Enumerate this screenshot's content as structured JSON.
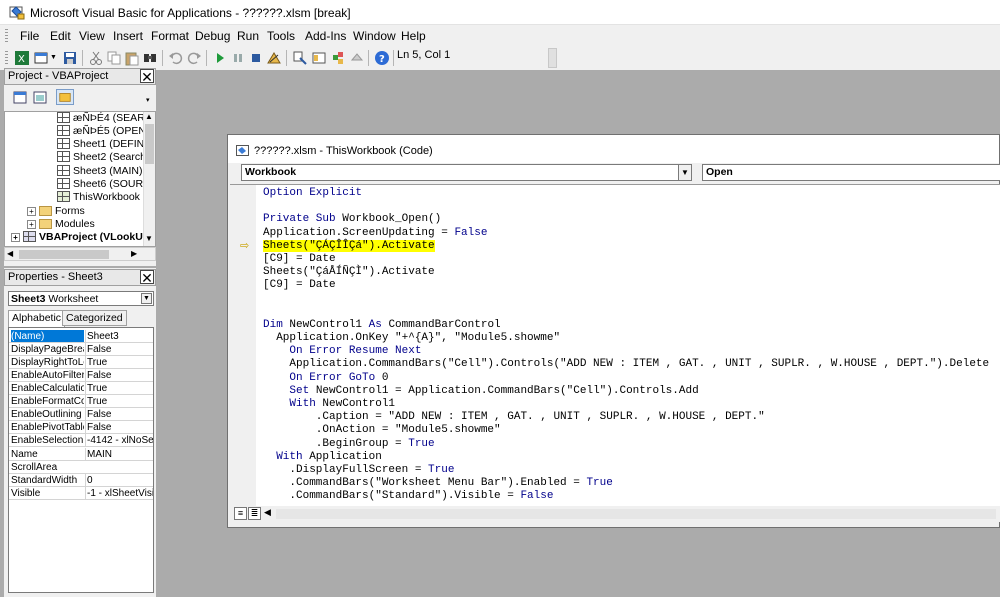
{
  "window": {
    "title": "Microsoft Visual Basic for Applications - ??????.xlsm [break]"
  },
  "menu": [
    "File",
    "Edit",
    "View",
    "Insert",
    "Format",
    "Debug",
    "Run",
    "Tools",
    "Add-Ins",
    "Window",
    "Help"
  ],
  "toolbar": {
    "icons": [
      "excel-icon",
      "insert-module-icon",
      "save-icon",
      "cut-icon",
      "copy-icon",
      "paste-icon",
      "find-icon",
      "undo-icon",
      "redo-icon",
      "run-icon",
      "break-icon",
      "reset-icon",
      "design-mode-icon",
      "project-explorer-icon",
      "properties-icon",
      "object-browser-icon",
      "toolbox-icon",
      "help-icon"
    ],
    "position": "Ln 5, Col 1"
  },
  "project": {
    "title": "Project - VBAProject",
    "close": "✕",
    "tree": [
      {
        "label": "æÑÞÉ4 (SEARCH",
        "type": "sheet"
      },
      {
        "label": "æÑÞÉ5 (OPENIN",
        "type": "sheet"
      },
      {
        "label": "Sheet1 (DEFINIT",
        "type": "sheet"
      },
      {
        "label": "Sheet2 (Search (",
        "type": "sheet"
      },
      {
        "label": "Sheet3 (MAIN)",
        "type": "sheet"
      },
      {
        "label": "Sheet6 (SOURCE",
        "type": "sheet"
      },
      {
        "label": "ThisWorkbook",
        "type": "workbook"
      },
      {
        "label": "Forms",
        "type": "folder"
      },
      {
        "label": "Modules",
        "type": "folder"
      },
      {
        "label": "VBAProject (VLookUp",
        "type": "project"
      }
    ]
  },
  "properties": {
    "title": "Properties - Sheet3",
    "close": "✕",
    "object_name": "Sheet3",
    "object_type": "Worksheet",
    "tabs": [
      "Alphabetic",
      "Categorized"
    ],
    "rows": [
      {
        "name": "(Name)",
        "value": "Sheet3"
      },
      {
        "name": "DisplayPageBreak",
        "value": "False"
      },
      {
        "name": "DisplayRightToLef",
        "value": "True"
      },
      {
        "name": "EnableAutoFilter",
        "value": "False"
      },
      {
        "name": "EnableCalculation",
        "value": "True"
      },
      {
        "name": "EnableFormatCon",
        "value": "True"
      },
      {
        "name": "EnableOutlining",
        "value": "False"
      },
      {
        "name": "EnablePivotTable",
        "value": "False"
      },
      {
        "name": "EnableSelection",
        "value": "-4142 - xlNoSele"
      },
      {
        "name": "Name",
        "value": "MAIN"
      },
      {
        "name": "ScrollArea",
        "value": ""
      },
      {
        "name": "StandardWidth",
        "value": "0"
      },
      {
        "name": "Visible",
        "value": "-1 - xlSheetVisib"
      }
    ]
  },
  "code_window": {
    "title": "??????.xlsm - ThisWorkbook (Code)",
    "object_combo": "Workbook",
    "proc_combo": "Open",
    "lines": [
      "Option Explicit",
      "",
      "Private Sub Workbook_Open()",
      "Application.ScreenUpdating = False",
      "Sheets(\"ÇÁÇÎÎÇá\").Activate",
      "[C9] = Date",
      "Sheets(\"ÇáÅÍÑÇÌ\").Activate",
      "[C9] = Date",
      "",
      "",
      "Dim NewControl1 As CommandBarControl",
      "  Application.OnKey \"+^{A}\", \"Module5.showme\"",
      "    On Error Resume Next",
      "    Application.CommandBars(\"Cell\").Controls(\"ADD NEW : ITEM , GAT. , UNIT , SUPLR. , W.HOUSE , DEPT.\").Delete",
      "    On Error GoTo 0",
      "    Set NewControl1 = Application.CommandBars(\"Cell\").Controls.Add",
      "    With NewControl1",
      "        .Caption = \"ADD NEW : ITEM , GAT. , UNIT , SUPLR. , W.HOUSE , DEPT.\"",
      "        .OnAction = \"Module5.showme\"",
      "        .BeginGroup = True",
      "  With Application",
      "    .DisplayFullScreen = True",
      "    .CommandBars(\"Worksheet Menu Bar\").Enabled = True",
      "    .CommandBars(\"Standard\").Visible = False"
    ],
    "highlight_line": 4,
    "colors": {
      "keyword": "#00008b",
      "highlight": "#ffff00"
    }
  }
}
